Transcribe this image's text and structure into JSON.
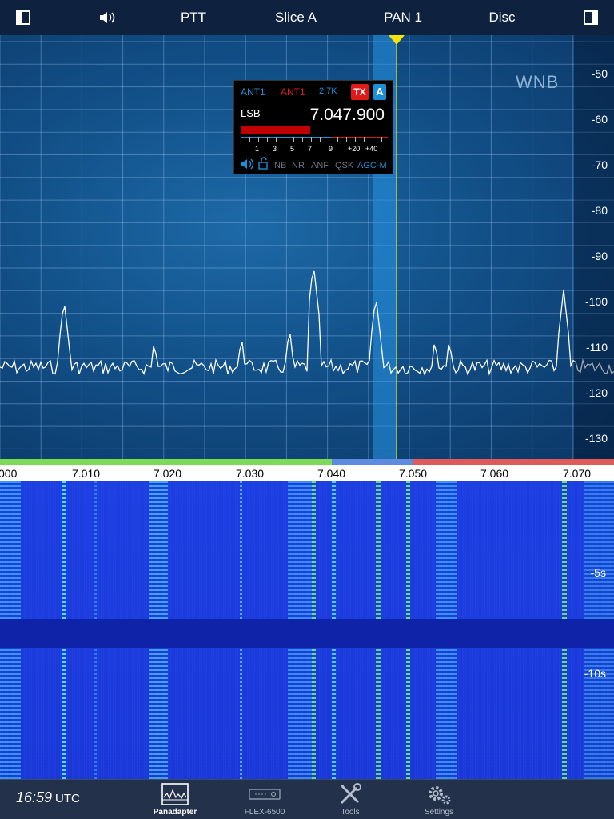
{
  "topbar": {
    "items": [
      "PTT",
      "Slice A",
      "PAN 1",
      "Disc"
    ]
  },
  "panadapter": {
    "wnb_label": "WNB",
    "dbm_labels": [
      "-50",
      "-60",
      "-70",
      "-80",
      "-90",
      "-100",
      "-110",
      "-120",
      "-130"
    ]
  },
  "slice_flag": {
    "rx_ant": "ANT1",
    "tx_ant": "ANT1",
    "filter_width": "2.7K",
    "tx_badge": "TX",
    "slice_letter": "A",
    "mode": "LSB",
    "frequency": "7.047.900",
    "smeter_level_fraction": 0.46,
    "smeter_labels": [
      "1",
      "3",
      "5",
      "7",
      "9",
      "+20",
      "+40"
    ],
    "options": [
      "NB",
      "NR",
      "ANF",
      "QSK",
      "AGC-M"
    ],
    "active_option": "AGC-M"
  },
  "frequency_scale": {
    "labels": [
      "000",
      "7.010",
      "7.020",
      "7.030",
      "7.040",
      "7.050",
      "7.060",
      "7.070"
    ]
  },
  "waterfall": {
    "time_labels": [
      "-5s",
      "-10s"
    ]
  },
  "statusbar": {
    "time": "16:59",
    "tz": "UTC"
  },
  "tabs": [
    {
      "label": "Panadapter",
      "active": true
    },
    {
      "label": "FLEX-6500",
      "active": false
    },
    {
      "label": "Tools",
      "active": false
    },
    {
      "label": "Settings",
      "active": false
    }
  ],
  "colors": {
    "accent": "#1d8fd6",
    "tx_red": "#e01a1a",
    "band_green": "#7ed957",
    "band_blue": "#5d8be0",
    "band_red": "#e05a5a",
    "marker_yellow": "#f5e400"
  }
}
